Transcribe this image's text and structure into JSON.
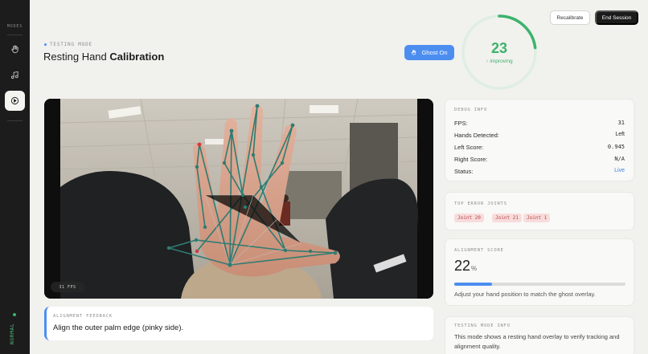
{
  "sidebar": {
    "mode_label": "MODES",
    "items": [
      {
        "icon": "hand-icon"
      },
      {
        "icon": "music-note-icon"
      },
      {
        "icon": "play-circle-icon",
        "active": true
      }
    ],
    "status_text": "NORMAL"
  },
  "header": {
    "mode_tag": "TESTING MODE",
    "title_regular": "Resting Hand ",
    "title_bold": "Calibration",
    "ghost_button": "Ghost On",
    "recalibrate_button": "Recalibrate",
    "end_session_button": "End Session"
  },
  "progress_ring": {
    "value": "23",
    "trend": "↑ improving",
    "fraction": 0.23,
    "color": "#3bb36a"
  },
  "camera": {
    "fps_chip": "31 FPS"
  },
  "feedback": {
    "label": "ALIGNMENT FEEDBACK",
    "message": "Align the outer palm edge (pinky side)."
  },
  "debug": {
    "label": "DEBUG INFO",
    "rows": [
      {
        "key": "FPS:",
        "value": "31"
      },
      {
        "key": "Hands Detected:",
        "value": "Left"
      },
      {
        "key": "Left Score:",
        "value": "0.945"
      },
      {
        "key": "Right Score:",
        "value": "N/A"
      },
      {
        "key": "Status:",
        "value": "Live"
      }
    ]
  },
  "error_joints": {
    "label": "TOP ERROR JOINTS",
    "joints": [
      "Joint 20",
      "Joint 21",
      "Joint 1"
    ]
  },
  "alignment": {
    "label": "ALIGNMENT SCORE",
    "value": "22",
    "unit": "%",
    "fraction": 0.22,
    "hint": "Adjust your hand position to match the ghost overlay."
  },
  "info": {
    "label": "TESTING MODE INFO",
    "text": "This mode shows a resting hand overlay to verify tracking and alignment quality."
  },
  "colors": {
    "accent": "#4c8ef0",
    "success": "#3bb36a",
    "error_chip": "#f8dcdc",
    "skeleton": "#2f7c72"
  }
}
